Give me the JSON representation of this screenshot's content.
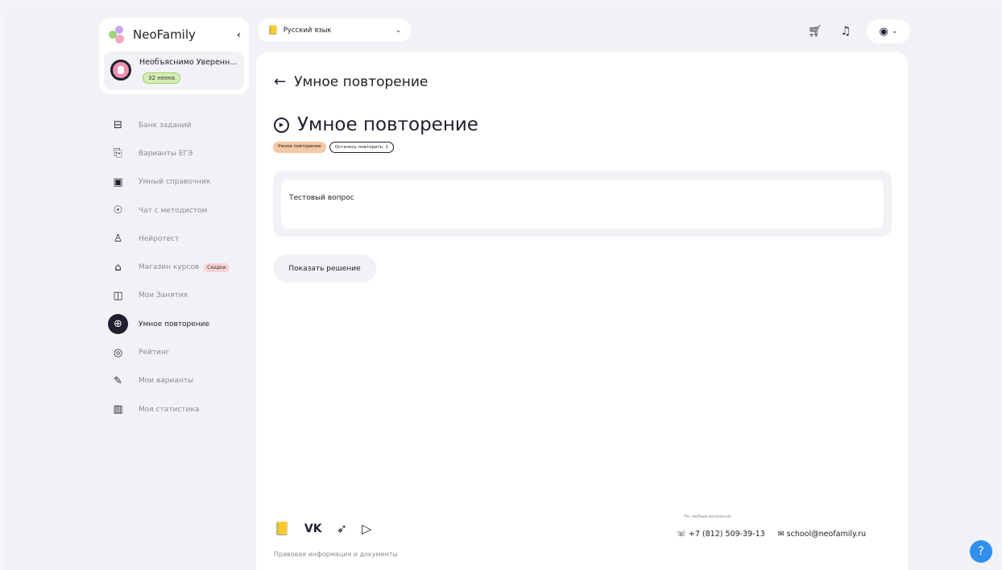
{
  "brand": {
    "name": "NeoFamily"
  },
  "user": {
    "name": "Необъяснимо Уверенн...",
    "balance": "32 неона"
  },
  "sidebar": {
    "items": [
      {
        "label": "Банк заданий",
        "icon": "archive-icon",
        "glyph": "⊟"
      },
      {
        "label": "Варианты ЕГЭ",
        "icon": "documents-icon",
        "glyph": "⎘"
      },
      {
        "label": "Умный справочник",
        "icon": "book-icon",
        "glyph": "▣"
      },
      {
        "label": "Чат с методистом",
        "icon": "chat-icon",
        "glyph": "☉"
      },
      {
        "label": "Нейротест",
        "icon": "robot-icon",
        "glyph": "♙"
      },
      {
        "label": "Магазин курсов",
        "icon": "graduation-cap-icon",
        "glyph": "⌂",
        "badge": "Скидки"
      },
      {
        "label": "Мои Занятия",
        "icon": "open-book-icon",
        "glyph": "◫"
      },
      {
        "label": "Умное повторение",
        "icon": "brain-icon",
        "glyph": "⊕",
        "active": true
      },
      {
        "label": "Рейтинг",
        "icon": "target-icon",
        "glyph": "◎"
      },
      {
        "label": "Мои варианты",
        "icon": "pencil-icon",
        "glyph": "✎"
      },
      {
        "label": "Моя статистика",
        "icon": "bar-chart-icon",
        "glyph": "▥"
      }
    ]
  },
  "topbar": {
    "subject": "Русский язык"
  },
  "page": {
    "back_title": "Умное повторение",
    "title": "Умное повторение",
    "tags": [
      "Умное повторение",
      "Осталось повторить: 1"
    ],
    "question": "Тестовый вопрос",
    "show_solution": "Показать решение"
  },
  "footer": {
    "legal": "Правовая информация и документы",
    "caption": "По любым вопросам",
    "phone": "+7 (812) 509-39-13",
    "email": "school@neofamily.ru"
  }
}
